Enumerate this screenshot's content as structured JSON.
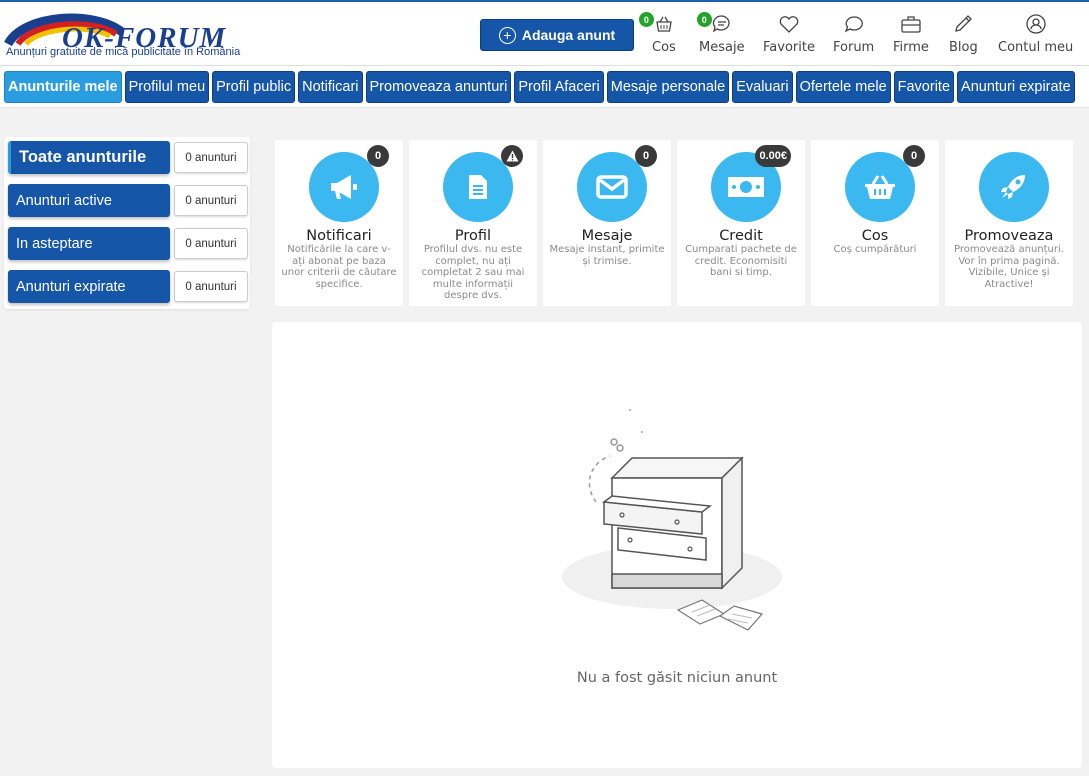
{
  "header": {
    "logo_text": "OK-FORUM",
    "logo_tagline": "Anunțuri gratuite de mică publicitate în România",
    "add_button": "Adauga anunt",
    "nav": [
      {
        "label": "Cos",
        "icon": "basket-icon",
        "badge": "0"
      },
      {
        "label": "Mesaje",
        "icon": "chat-bubble-icon",
        "badge": "0"
      },
      {
        "label": "Favorite",
        "icon": "heart-icon"
      },
      {
        "label": "Forum",
        "icon": "speech-bubble-icon"
      },
      {
        "label": "Firme",
        "icon": "briefcase-icon"
      },
      {
        "label": "Blog",
        "icon": "pencil-icon"
      },
      {
        "label": "Contul meu",
        "icon": "user-icon"
      }
    ]
  },
  "tabs": [
    "Anunturile mele",
    "Profilul meu",
    "Profil public",
    "Notificari",
    "Promoveaza anunturi",
    "Profil Afaceri",
    "Mesaje personale",
    "Evaluari",
    "Ofertele mele",
    "Favorite",
    "Anunturi expirate"
  ],
  "sidebar": [
    {
      "label": "Toate anunturile",
      "count": "0 anunturi"
    },
    {
      "label": "Anunturi active",
      "count": "0 anunturi"
    },
    {
      "label": "In asteptare",
      "count": "0 anunturi"
    },
    {
      "label": "Anunturi expirate",
      "count": "0 anunturi"
    }
  ],
  "cards": [
    {
      "title": "Notificari",
      "badge": "0",
      "icon": "megaphone-icon",
      "desc": "Notificările la care v-ați abonat pe baza unor criterii de căutare specifice."
    },
    {
      "title": "Profil",
      "badge": "⚠",
      "icon": "document-icon",
      "desc": "Profilul dvs. nu este complet, nu ați completat 2 sau mai multe informații despre dvs."
    },
    {
      "title": "Mesaje",
      "badge": "0",
      "icon": "envelope-icon",
      "desc": "Mesaje instant, primite și trimise."
    },
    {
      "title": "Credit",
      "badge": "0.00€",
      "icon": "banknote-icon",
      "desc": "Cumparati pachete de credit. Economisiti bani si timp."
    },
    {
      "title": "Cos",
      "badge": "0",
      "icon": "basket-icon",
      "desc": "Coș cumpărături"
    },
    {
      "title": "Promoveaza",
      "badge": "",
      "icon": "rocket-icon",
      "desc": "Promovează anunțuri. Vor în prima pagină. Vizibile, Unice și Atractive!"
    }
  ],
  "empty": {
    "message": "Nu a fost găsit niciun anunt",
    "icon": "empty-drawer-illustration"
  },
  "colors": {
    "primary": "#1556a8",
    "active_tab": "#2a9de0",
    "card_icon": "#3ab8ef",
    "badge_green": "#22a32a"
  }
}
